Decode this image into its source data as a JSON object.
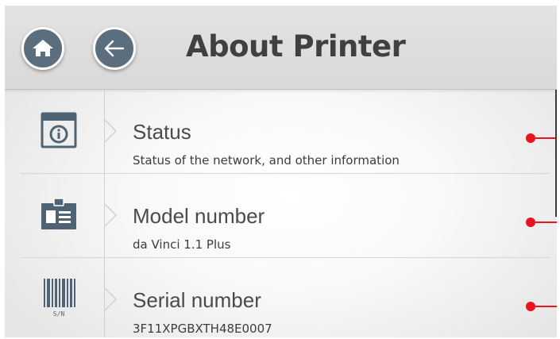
{
  "header": {
    "title": "About Printer"
  },
  "items": [
    {
      "label": "Status",
      "detail": "Status of the network, and other information",
      "icon": "status-info-icon"
    },
    {
      "label": "Model number",
      "detail": "da Vinci 1.1 Plus",
      "icon": "id-badge-icon"
    },
    {
      "label": "Serial number",
      "detail": "3F11XPGBXTH48E0007",
      "icon": "barcode-sn-icon",
      "icon_caption": "S/N"
    }
  ],
  "colors": {
    "header_bg": "#dedede",
    "button_bg": "#5b6e7d",
    "icon_color": "#4e6474",
    "callout_red": "#e8141e"
  }
}
